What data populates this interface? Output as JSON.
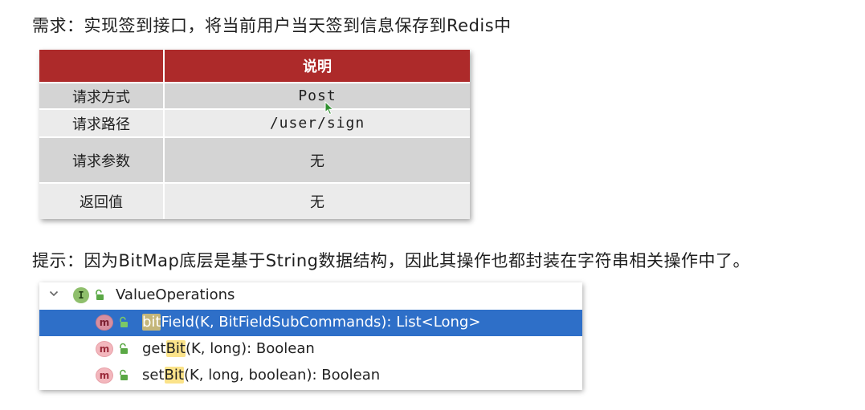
{
  "requirement": "需求：实现签到接口，将当前用户当天签到信息保存到Redis中",
  "table": {
    "header": [
      "",
      "说明"
    ],
    "rows": [
      {
        "label": "请求方式",
        "value": "Post"
      },
      {
        "label": "请求路径",
        "value": "/user/sign"
      },
      {
        "label": "请求参数",
        "value": "无"
      },
      {
        "label": "返回值",
        "value": "无"
      }
    ]
  },
  "hint": "提示：因为BitMap底层是基于String数据结构，因此其操作也都封装在字符串相关操作中了。",
  "tree": {
    "parent": {
      "label": "ValueOperations",
      "icon": "interface-icon",
      "badge": "I"
    },
    "methods": [
      {
        "badge": "m",
        "match": "bit",
        "name_rest": "Field",
        "signature": "(K, BitFieldSubCommands): List<Long>",
        "selected": true
      },
      {
        "badge": "m",
        "prefix": "get",
        "match": "Bit",
        "name_rest": "",
        "signature": "(K, long): Boolean",
        "selected": false
      },
      {
        "badge": "m",
        "prefix": "set",
        "match": "Bit",
        "name_rest": "",
        "signature": "(K, long, boolean): Boolean",
        "selected": false
      }
    ]
  },
  "colors": {
    "table_header": "#ad2a2a",
    "row_dark": "#d4d4d4",
    "row_light": "#ebebeb",
    "selection": "#2e6fc8",
    "match_highlight": "#fbe38a"
  }
}
